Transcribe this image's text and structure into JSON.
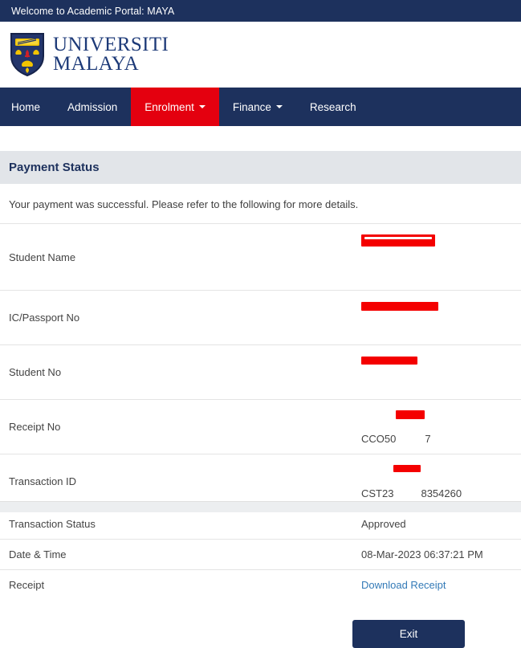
{
  "topbar": {
    "welcome_text": "Welcome to Academic Portal: MAYA",
    "background_color": "#1d315d"
  },
  "brand": {
    "line1": "UNIVERSITI",
    "line2": "MALAYA",
    "crest_icon": "university-crest-icon",
    "text_color": "#1d3a78"
  },
  "nav": {
    "active_color": "#e4000f",
    "items": [
      {
        "label": "Home",
        "active": false,
        "has_caret": false
      },
      {
        "label": "Admission",
        "active": false,
        "has_caret": false
      },
      {
        "label": "Enrolment",
        "active": true,
        "has_caret": true
      },
      {
        "label": "Finance",
        "active": false,
        "has_caret": true
      },
      {
        "label": "Research",
        "active": false,
        "has_caret": false
      }
    ]
  },
  "panel": {
    "title": "Payment Status",
    "header_background": "#e2e5e9",
    "intro": "Your payment was successful. Please refer to the following for more details."
  },
  "details": {
    "rows": [
      {
        "label": "Student Name",
        "value": "",
        "redacted": "full",
        "redact_width": 92,
        "kind": "text"
      },
      {
        "label": "IC/Passport No",
        "value": "",
        "redacted": "full",
        "redact_width": 96,
        "kind": "text"
      },
      {
        "label": "Student No",
        "value": "",
        "redacted": "full",
        "redact_width": 70,
        "kind": "text"
      },
      {
        "label": "Receipt No",
        "value": "CCO50",
        "value_suffix": "7",
        "redacted": "partial",
        "redact_width": 36,
        "kind": "text"
      },
      {
        "label": "Transaction ID",
        "value": "CST23",
        "value_suffix": "8354260",
        "redacted": "partial",
        "redact_width": 34,
        "kind": "text"
      },
      {
        "label": "Transaction Status",
        "value": "Approved",
        "redacted": "none",
        "kind": "status"
      },
      {
        "label": "Date & Time",
        "value": "08-Mar-2023 06:37:21 PM",
        "redacted": "none",
        "kind": "text"
      },
      {
        "label": "Receipt",
        "value": "Download Receipt",
        "redacted": "none",
        "kind": "link"
      }
    ],
    "status_color": "#3c763d",
    "link_color": "#337ab7"
  },
  "actions": {
    "exit_label": "Exit",
    "exit_color": "#1d315d"
  }
}
